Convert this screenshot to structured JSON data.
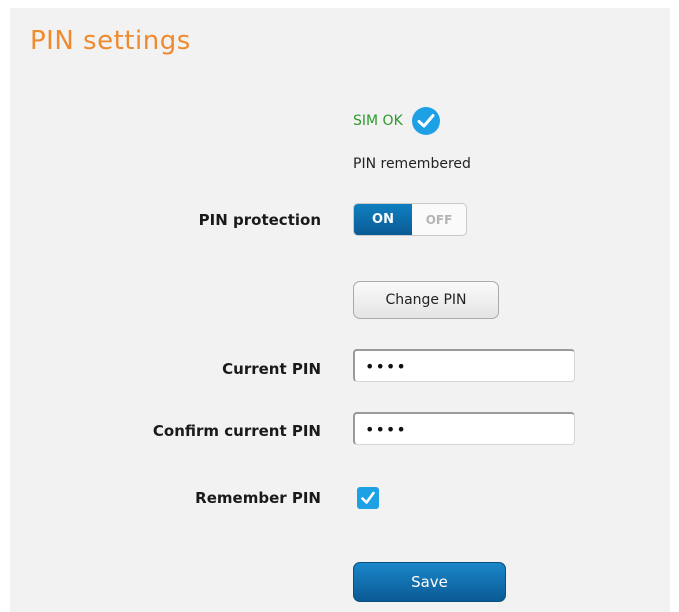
{
  "section": {
    "title": "PIN settings"
  },
  "status": {
    "sim_status": "SIM OK",
    "sim_icon": "check-circle-icon",
    "pin_status": "PIN remembered"
  },
  "pin_protection": {
    "label": "PIN protection",
    "on_label": "ON",
    "off_label": "OFF",
    "value": "ON"
  },
  "change_pin": {
    "label": "Change PIN"
  },
  "current_pin": {
    "label": "Current PIN",
    "value": "••••"
  },
  "confirm_pin": {
    "label": "Confirm current PIN",
    "value": "••••"
  },
  "remember_pin": {
    "label": "Remember PIN",
    "checked": true
  },
  "save": {
    "label": "Save"
  },
  "colors": {
    "title": "#ef8a2f",
    "sim_ok": "#2e9a2e",
    "accent": "#1da1e4",
    "button_primary": "#0b5a95",
    "panel_bg": "#f2f2f2"
  }
}
